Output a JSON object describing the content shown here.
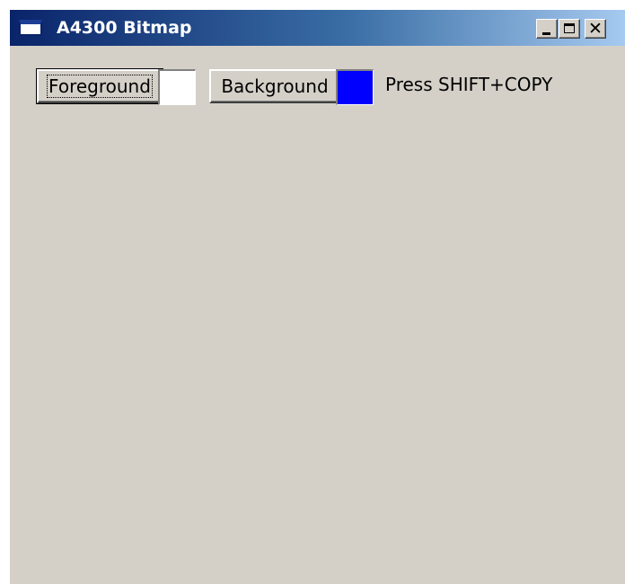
{
  "window": {
    "title": "A4300 Bitmap",
    "titlebar_colors": [
      "#0a246a",
      "#a6caf0"
    ],
    "controls": {
      "minimize": "minimize-icon",
      "maximize": "maximize-icon",
      "close": "close-icon"
    }
  },
  "toolbar": {
    "foreground_label": "Foreground",
    "foreground_color": "#ffffff",
    "background_label": "Background",
    "background_color": "#0000ff",
    "hint": "Press SHIFT+COPY"
  }
}
